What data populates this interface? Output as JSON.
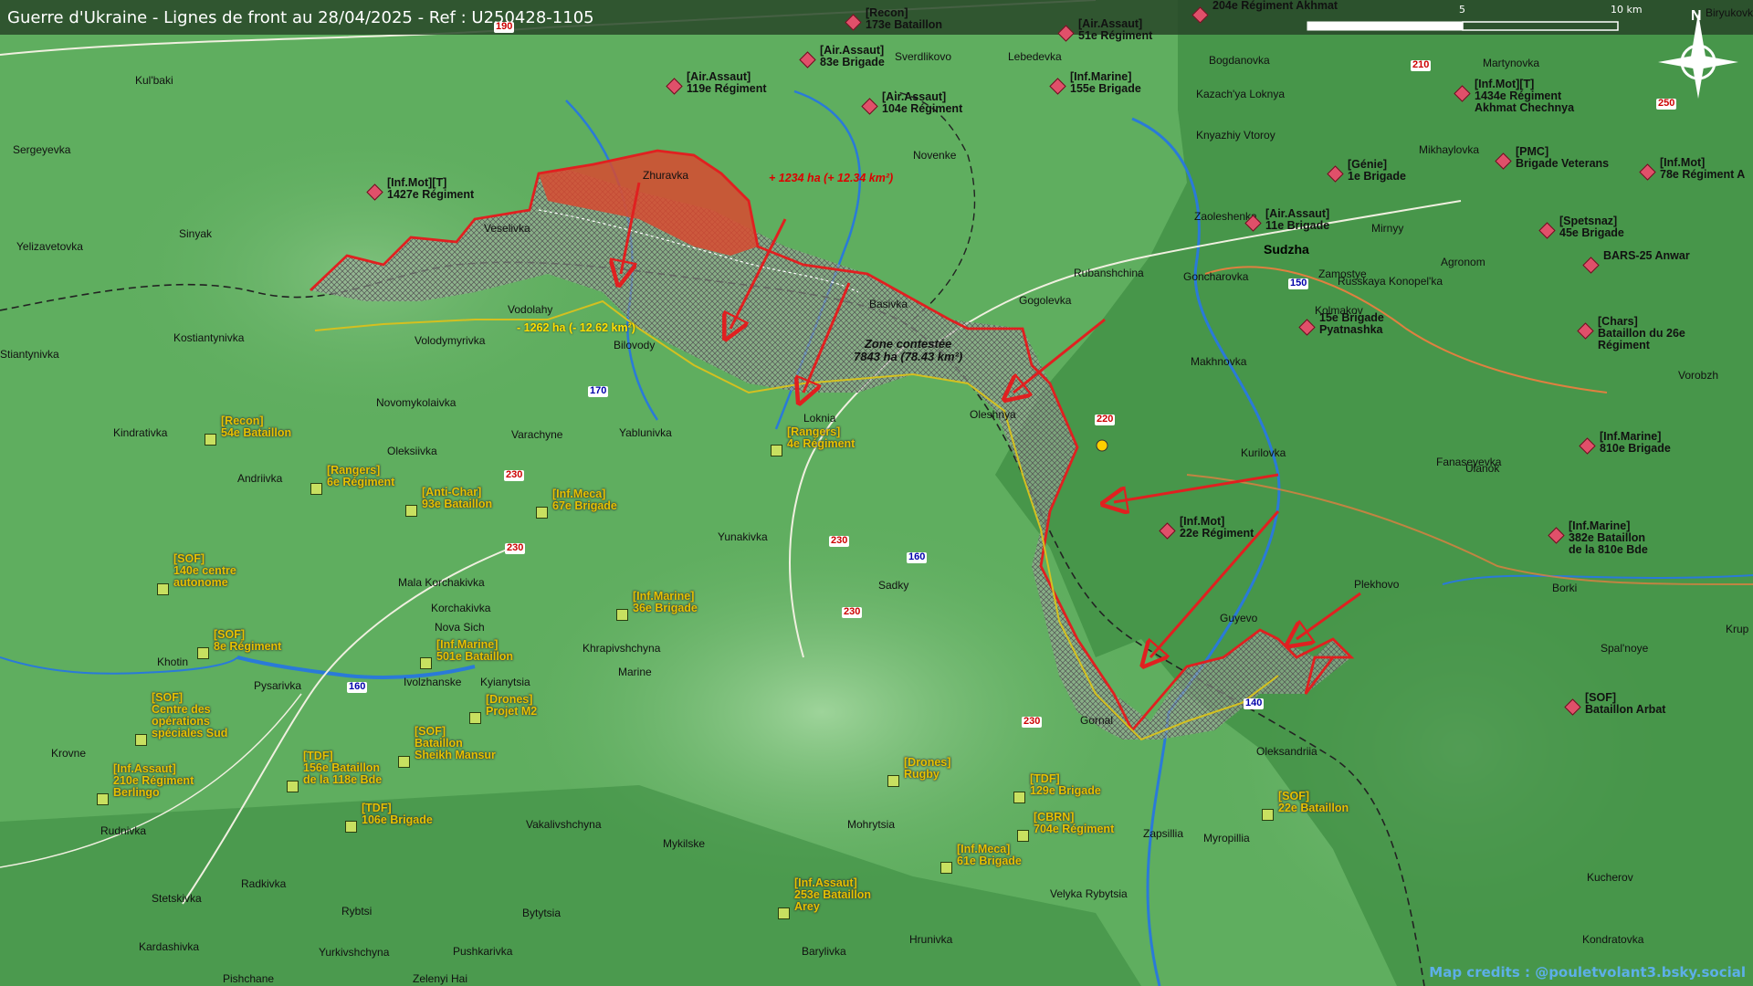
{
  "title": "Guerre d'Ukraine - Lignes de front au 28/04/2025 - Ref : U250428-1105",
  "scale": {
    "zero": "",
    "five": "5",
    "ten": "10 km"
  },
  "north": "N",
  "credits": "Map credits : @pouletvolant3.bsky.social",
  "annotations": {
    "gain": "+ 1234 ha (+ 12.34 km²)",
    "loss": "- 1262 ha (- 12.62 km²)",
    "zone_title": "Zone contestée",
    "zone_area": "7843 ha (78.43 km²)"
  },
  "places": [
    "Kul'baki",
    "Sergeyevka",
    "Sinyak",
    "Yelizavetovka",
    "Kostiantynivka",
    "Stiantynivka",
    "Veselivka",
    "Zhuravka",
    "Vodolahy",
    "Volodymyrivka",
    "Bilovody",
    "Novomykolaivka",
    "Kindrativka",
    "Oleksiivka",
    "Varachyne",
    "Andriivka",
    "Yablunivka",
    "Loknia",
    "Yunakivka",
    "Mala Korchakivka",
    "Korchakivka",
    "Nova Sich",
    "Khotin",
    "Pysarivka",
    "Kyianytsia",
    "Khrapivshchyna",
    "Marine",
    "Ivolzhanske",
    "Krovne",
    "Rudnivka",
    "Vakalivshchyna",
    "Mykilske",
    "Mohrytsia",
    "Sadky",
    "Radkivka",
    "Stetskivka",
    "Rybtsi",
    "Bytytsia",
    "Kardashivka",
    "Yurkivshchyna",
    "Pushkarivka",
    "Pishchane",
    "Zelenyi Hai",
    "Barylivka",
    "Hrunivka",
    "Velyka Rybytsia",
    "Zapsillia",
    "Myropillia",
    "Oleksandriia",
    "Gornal",
    "Guyevo",
    "Plekhovo",
    "Kurilovka",
    "Oleshnya",
    "Basivka",
    "Gogolevka",
    "Rubanshchina",
    "Novenke",
    "Sverdlikovo",
    "Lebedevka",
    "Bogdanovka",
    "Kazach'ya Loknya",
    "Knyazhiy Vtoroy",
    "Zaoleshenka",
    "Sudzha",
    "Goncharovka",
    "Zamostye",
    "Mirnyy",
    "Makhnovka",
    "Kolmakov",
    "Agronom",
    "Russkaya Konopel'ka",
    "Mikhaylovka",
    "Martynovka",
    "Fanaseyevka",
    "Ulanok",
    "Borki",
    "Spal'noye",
    "Kucherov",
    "Kondratovka",
    "Vorobzh",
    "Krup",
    "Biryukovka"
  ],
  "roads": [
    "190",
    "210",
    "250",
    "150",
    "220",
    "230",
    "230",
    "230",
    "230",
    "230",
    "160",
    "160",
    "170",
    "140"
  ],
  "units_ru": [
    "[Recon]",
    "173e Bataillon",
    "204e Régiment Akhmat",
    "[Air.Assaut]",
    "51e Régiment",
    "[Air.Assaut]",
    "83e Brigade",
    "[Air.Assaut]",
    "119e Régiment",
    "[Air.Assaut]",
    "104e Régiment",
    "[Inf.Marine]",
    "155e Brigade",
    "[Inf.Mot][T]",
    "1434e Régiment",
    "Akhmat Chechnya",
    "[Inf.Mot][T]",
    "1427e Régiment",
    "[Génie]",
    "1e Brigade",
    "[PMC]",
    "Brigade Veterans",
    "[Inf.Mot]",
    "78e Régiment A",
    "[Air.Assaut]",
    "11e Brigade",
    "[Spetsnaz]",
    "45e Brigade",
    "BARS-25 Anwar",
    "15e Brigade",
    "Pyatnashka",
    "[Chars]",
    "Bataillon du 26e",
    "Régiment",
    "[Inf.Marine]",
    "810e Brigade",
    "[Inf.Mot]",
    "22e Régiment",
    "[Inf.Marine]",
    "382e Bataillon",
    "de la 810e Bde",
    "[SOF]",
    "Bataillon Arbat"
  ],
  "units_ua": [
    "[Recon]",
    "54e Bataillon",
    "[Rangers]",
    "6e Régiment",
    "[Anti-Char]",
    "93e Bataillon",
    "[Inf.Meca]",
    "67e Brigade",
    "[Rangers]",
    "4e Régiment",
    "[SOF]",
    "140e centre",
    "autonome",
    "[Inf.Marine]",
    "36e Brigade",
    "[SOF]",
    "8e Régiment",
    "[Inf.Marine]",
    "501e Bataillon",
    "[Drones]",
    "Projet M2",
    "[SOF]",
    "Centre des",
    "opérations",
    "spéciales Sud",
    "[SOF]",
    "Bataillon",
    "Sheikh Mansur",
    "[TDF]",
    "156e Bataillon",
    "de la 118e Bde",
    "[Inf.Assaut]",
    "210e Régiment",
    "Berlingo",
    "[TDF]",
    "106e Brigade",
    "[Drones]",
    "Rugby",
    "[TDF]",
    "129e Brigade",
    "[CBRN]",
    "704e Régiment",
    "[Inf.Meca]",
    "61e Brigade",
    "[SOF]",
    "22e Bataillon",
    "[Inf.Assaut]",
    "253e Bataillon",
    "Arey"
  ],
  "colors": {
    "ru": "#e0506a",
    "ua": "#c8e060",
    "front": "#e02020",
    "contested": "#9aa098",
    "gain": "#e05030",
    "uaLine": "#d4c020"
  }
}
